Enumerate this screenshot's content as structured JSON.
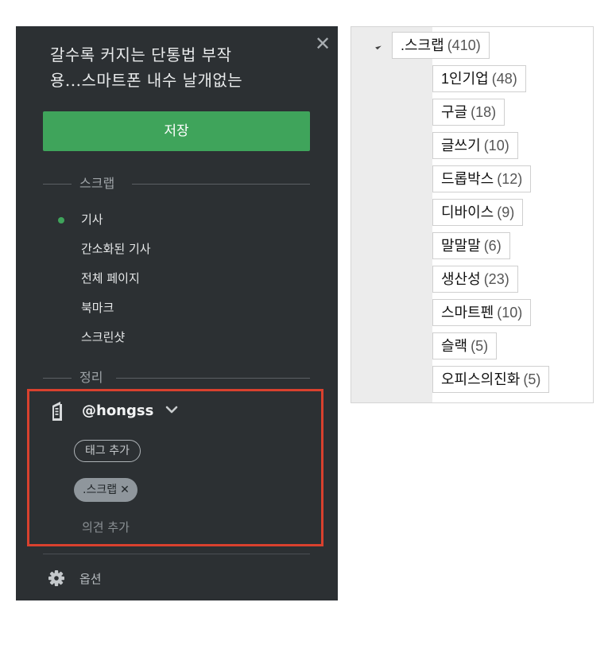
{
  "clipper": {
    "close_glyph": "✕",
    "title_line1": "갈수록 커지는 단통법 부작",
    "title_line2": "용...스마트폰 내수 날개없는",
    "save_label": "저장",
    "section_scrap": "스크랩",
    "clip_types": [
      "기사",
      "간소화된 기사",
      "전체 페이지",
      "북마크",
      "스크린샷"
    ],
    "selected_clip_type": "기사",
    "section_organize": "정리",
    "notebook": "@hongss",
    "add_tag_label": "태그 추가",
    "applied_tag": ".스크랩",
    "remove_tag_glyph": "✕",
    "add_comment_label": "의견 추가",
    "options_label": "옵션",
    "accent_color": "#3fa45b",
    "highlight_color": "#d9412e"
  },
  "tag_tree": {
    "root": {
      "name": ".스크랩",
      "count": "(410)"
    },
    "children": [
      {
        "name": "1인기업",
        "count": "(48)"
      },
      {
        "name": "구글",
        "count": "(18)"
      },
      {
        "name": "글쓰기",
        "count": "(10)"
      },
      {
        "name": "드롭박스",
        "count": "(12)"
      },
      {
        "name": "디바이스",
        "count": "(9)"
      },
      {
        "name": "말말말",
        "count": "(6)"
      },
      {
        "name": "생산성",
        "count": "(23)"
      },
      {
        "name": "스마트펜",
        "count": "(10)"
      },
      {
        "name": "슬랙",
        "count": "(5)"
      },
      {
        "name": "오피스의진화",
        "count": "(5)"
      }
    ]
  }
}
